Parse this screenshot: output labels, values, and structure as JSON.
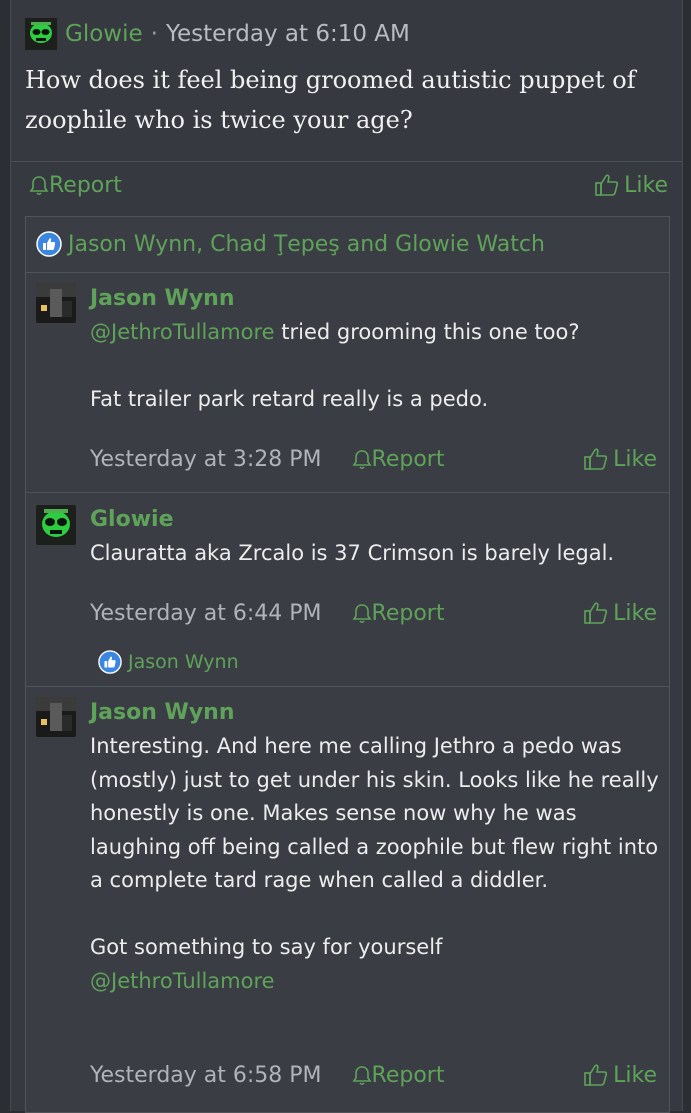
{
  "post": {
    "author": "Glowie",
    "separator": "·",
    "time": "Yesterday at 6:10 AM",
    "body": "How does it feel being groomed autistic puppet of zoophile who is twice your age?",
    "report_label": "Report",
    "like_label": "Like"
  },
  "reactions": {
    "text": "Jason Wynn, Chad Ţepeş and Glowie Watch"
  },
  "comments": [
    {
      "author": "Jason Wynn",
      "mention": "@JethroTullamore",
      "text1_rest": " tried grooming this one too?",
      "text2": "Fat trailer park retard really is a pedo.",
      "time": "Yesterday at 3:28 PM",
      "report_label": "Report",
      "like_label": "Like"
    },
    {
      "author": "Glowie",
      "text1": "Clauratta aka Zrcalo is 37 Crimson is barely legal.",
      "time": "Yesterday at 6:44 PM",
      "report_label": "Report",
      "like_label": "Like",
      "reactions": "Jason Wynn"
    },
    {
      "author": "Jason Wynn",
      "text1": "Interesting. And here me calling Jethro a pedo was (mostly) just to get under his skin. Looks like he really honestly is one. Makes sense now why he was laughing off being called a zoophile but flew right into a complete tard rage when called a diddler.",
      "text2": "Got something to say for yourself",
      "mention": "@JethroTullamore",
      "time": "Yesterday at 6:58 PM",
      "report_label": "Report",
      "like_label": "Like"
    }
  ],
  "colors": {
    "accent": "#5fa35a",
    "background": "#36393f",
    "comment_bg": "#3a3d43",
    "like_badge": "#3a86e0"
  },
  "icons": {
    "report": "bell-icon",
    "like": "thumbs-up-icon",
    "reaction": "like-reaction-icon",
    "glowie_avatar": "alien-avatar-icon"
  }
}
